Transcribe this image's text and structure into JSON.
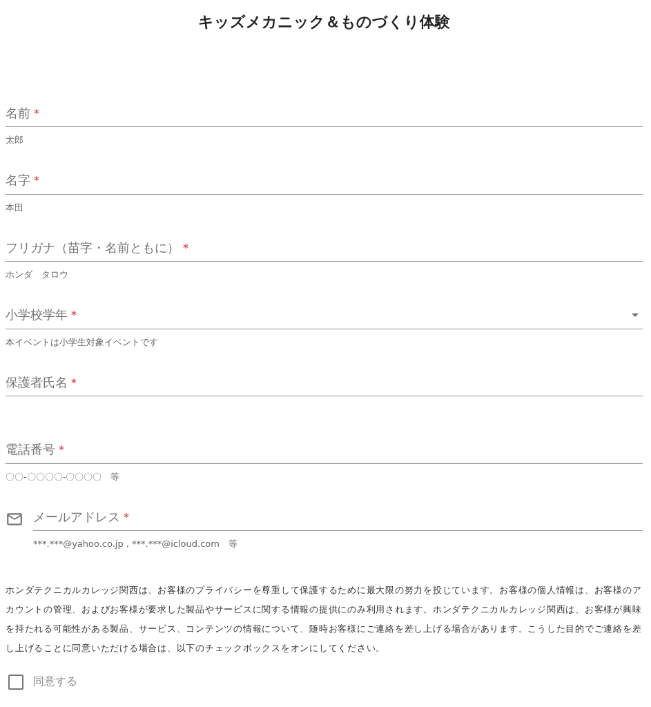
{
  "title": "キッズメカニック＆ものづくり体験",
  "fields": [
    {
      "kind": "text",
      "label": "名前",
      "required_mark": "*",
      "hint": "太郎"
    },
    {
      "kind": "text",
      "label": "名字",
      "required_mark": "*",
      "hint": "本田"
    },
    {
      "kind": "text",
      "label": "フリガナ（苗字・名前ともに）",
      "required_mark": "*",
      "hint": "ホンダ　タロウ"
    },
    {
      "kind": "select",
      "label": "小学校学年",
      "required_mark": "*",
      "hint": "本イベントは小学生対象イベントです"
    },
    {
      "kind": "text",
      "label": "保護者氏名",
      "required_mark": "*"
    },
    {
      "kind": "text",
      "label": "電話番号",
      "required_mark": "*",
      "hint": "〇〇-〇〇〇〇-〇〇〇〇　等"
    },
    {
      "kind": "email",
      "label": "メールアドレス",
      "required_mark": "*",
      "hint": "***.***@yahoo.co.jp , ***.***@icloud.com　等"
    }
  ],
  "privacy_text": "ホンダテクニカルカレッジ関西は、お客様のプライバシーを尊重して保護するために最大限の努力を投じています。お客様の個人情報は、お客様のアカウントの管理、およびお客様が要求した製品やサービスに関する情報の提供にのみ利用されます。ホンダテクニカルカレッジ関西は、お客様が興味を持たれる可能性がある製品、サービス、コンテンツの情報について、随時お客様にご連絡を差し上げる場合があります。こうした目的でご連絡を差し上げることに同意いただける場合は、以下のチェックボックスをオンにしてください。",
  "consent": {
    "label": "同意する",
    "checked": false
  }
}
